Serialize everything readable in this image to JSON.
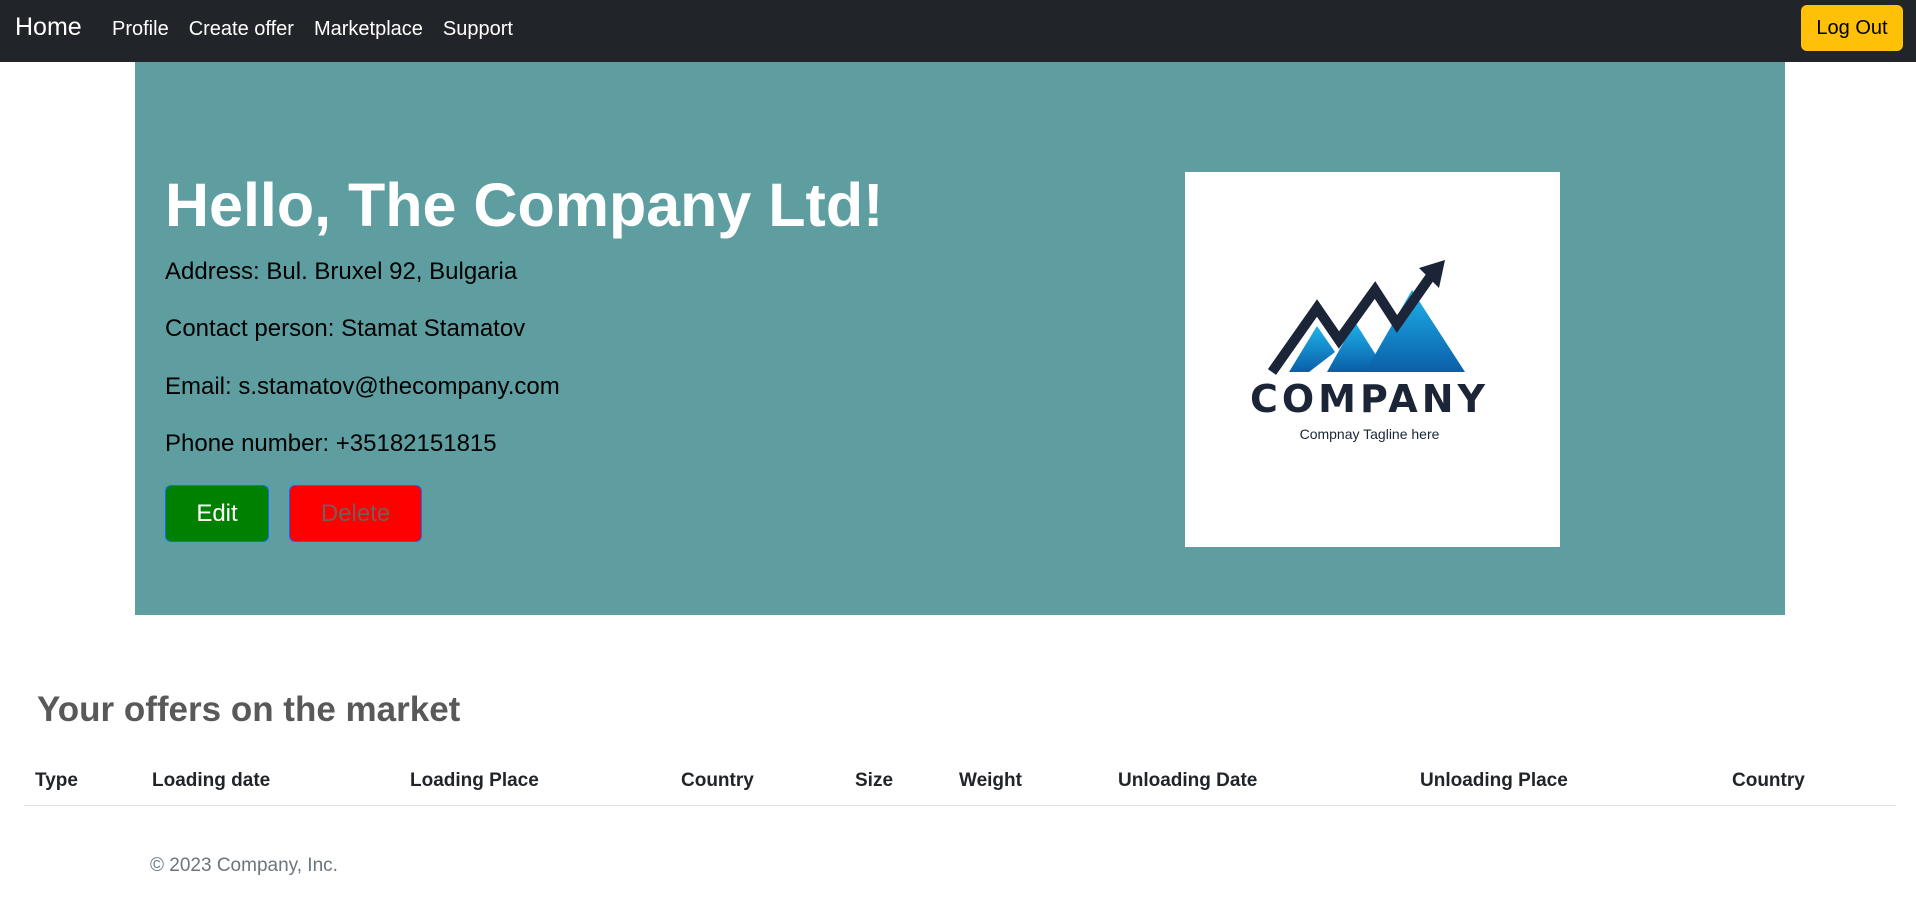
{
  "navbar": {
    "brand": "Home",
    "links": [
      "Profile",
      "Create offer",
      "Marketplace",
      "Support"
    ],
    "logout_label": "Log Out"
  },
  "profile": {
    "greeting": "Hello, The Company Ltd!",
    "address": "Address: Bul. Bruxel 92, Bulgaria",
    "contact": "Contact person: Stamat Stamatov",
    "email": "Email: s.stamatov@thecompany.com",
    "phone": "Phone number: +35182151815",
    "edit_label": "Edit",
    "delete_label": "Delete",
    "logo": {
      "wordmark": "COMPANY",
      "tagline": "Compnay Tagline here"
    }
  },
  "offers": {
    "title": "Your offers on the market",
    "columns": [
      "Type",
      "Loading date",
      "Loading Place",
      "Country",
      "Size",
      "Weight",
      "Unloading Date",
      "Unloading Place",
      "Country"
    ],
    "rows": []
  },
  "footer": {
    "copyright": "© 2023 Company, Inc."
  },
  "colors": {
    "navbar_bg": "#212529",
    "hero_bg": "#5f9ea0",
    "logout_bg": "#ffc107",
    "edit_bg": "#008000",
    "delete_bg": "#ff0000"
  }
}
